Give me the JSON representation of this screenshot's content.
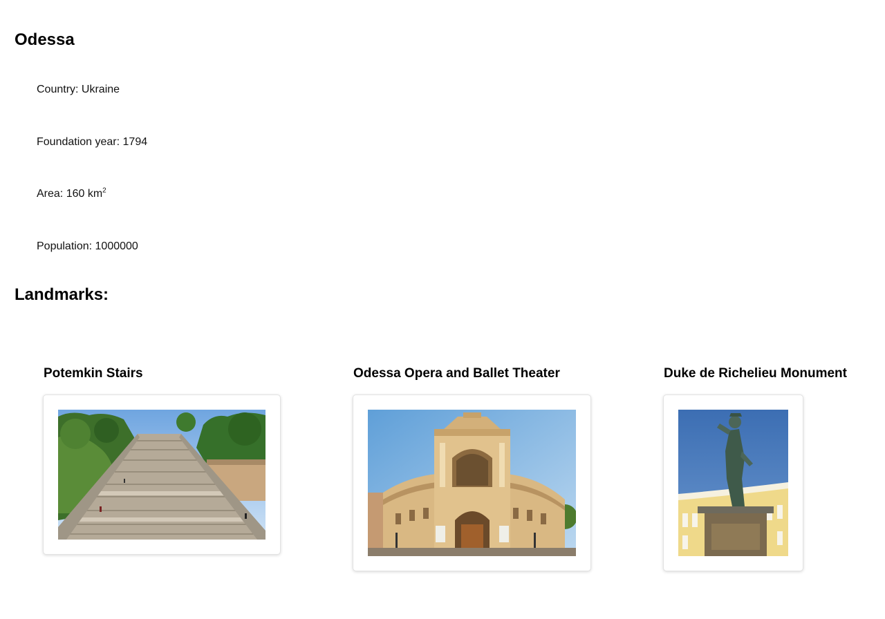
{
  "city": {
    "name": "Odessa",
    "facts": {
      "country_label": "Country: ",
      "country": "Ukraine",
      "foundation_label": "Foundation year: ",
      "foundation_year": "1794",
      "area_label": "Area: ",
      "area_value": "160 km",
      "area_unit_sup": "2",
      "population_label": "Population: ",
      "population": "1000000"
    }
  },
  "landmarks": {
    "heading": "Landmarks:",
    "items": [
      {
        "name": "Potemkin Stairs",
        "photo_icon": "stairs-photo"
      },
      {
        "name": "Odessa Opera and Ballet Theater",
        "photo_icon": "opera-theater-photo"
      },
      {
        "name": "Duke de Richelieu Monument",
        "photo_icon": "statue-photo"
      }
    ]
  },
  "colors": {
    "sky": "#7fb1e0",
    "stone": "#b9ad9c",
    "foliage": "#3f7a2e",
    "facade": "#dcbb86",
    "bronze": "#4c6658"
  }
}
